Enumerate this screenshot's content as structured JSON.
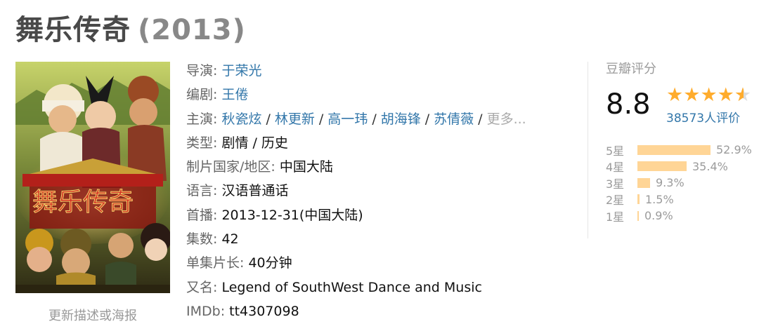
{
  "title": {
    "name": "舞乐传奇",
    "year": "(2013)"
  },
  "poster": {
    "update_link": "更新描述或海报"
  },
  "info": {
    "director_label": "导演:",
    "director": "于荣光",
    "writer_label": "编剧:",
    "writer": "王倦",
    "cast_label": "主演:",
    "cast": [
      "秋瓷炫",
      "林更新",
      "高一玮",
      "胡海锋",
      "苏倩薇"
    ],
    "cast_more": "更多...",
    "genre_label": "类型:",
    "genre": "剧情 / 历史",
    "country_label": "制片国家/地区:",
    "country": "中国大陆",
    "language_label": "语言:",
    "language": "汉语普通话",
    "premiere_label": "首播:",
    "premiere": "2013-12-31(中国大陆)",
    "episodes_label": "集数:",
    "episodes": "42",
    "runtime_label": "单集片长:",
    "runtime": "40分钟",
    "aka_label": "又名:",
    "aka": "Legend of SouthWest Dance and Music",
    "imdb_label": "IMDb:",
    "imdb": "tt4307098"
  },
  "rating": {
    "title": "豆瓣评分",
    "score": "8.8",
    "stars": 4.5,
    "votes": "38573人评价",
    "star_color": "#ffac2d",
    "bar_color": "#ffd596",
    "distribution": [
      {
        "label": "5星",
        "value": 52.9,
        "text": "52.9%"
      },
      {
        "label": "4星",
        "value": 35.4,
        "text": "35.4%"
      },
      {
        "label": "3星",
        "value": 9.3,
        "text": "9.3%"
      },
      {
        "label": "2星",
        "value": 1.5,
        "text": "1.5%"
      },
      {
        "label": "1星",
        "value": 0.9,
        "text": "0.9%"
      }
    ]
  }
}
